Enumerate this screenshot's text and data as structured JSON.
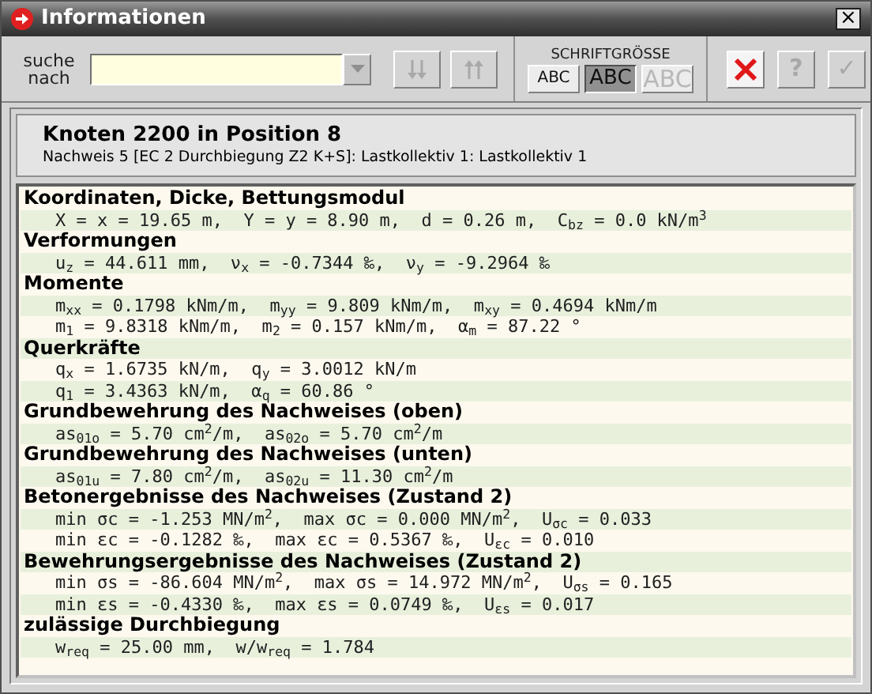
{
  "window": {
    "title": "Informationen",
    "close": "×"
  },
  "search": {
    "label": "suche nach"
  },
  "toolbar": {
    "down_disabled": true,
    "up_disabled": true
  },
  "font_size": {
    "label": "SCHRIFTGRÖSSE",
    "options": [
      {
        "label": "ABC",
        "selected": false,
        "disabled": false
      },
      {
        "label": "ABC",
        "selected": true,
        "disabled": false
      },
      {
        "label": "ABC",
        "selected": false,
        "disabled": true
      }
    ]
  },
  "actions": [
    {
      "kind": "close",
      "disabled": false
    },
    {
      "kind": "help",
      "label": "?",
      "disabled": true
    },
    {
      "kind": "ok",
      "label": "✓",
      "disabled": true
    }
  ],
  "header": {
    "title": "Knoten 2200 in Position 8",
    "subtitle": "Nachweis 5 [EC 2 Durchbiegung Z2 K+S]: Lastkollektiv 1: Lastkollektiv 1"
  },
  "lines": [
    {
      "kind": "heading",
      "text": "Koordinaten, Dicke, Bettungsmodul"
    },
    {
      "kind": "values",
      "text": "X = x = 19.65 m,  Y = y = 8.90 m,  d = 0.26 m,  C$_{bz}$ = 0.0 kN/m$^{3}$"
    },
    {
      "kind": "heading",
      "text": "Verformungen"
    },
    {
      "kind": "values",
      "text": "u$_{z}$ = 44.611 mm,  ν$_{x}$ = -0.7344 ‰,  ν$_{y}$ = -9.2964 ‰"
    },
    {
      "kind": "heading",
      "text": "Momente"
    },
    {
      "kind": "values",
      "text": "m$_{xx}$ = 0.1798 kNm/m,  m$_{yy}$ = 9.809 kNm/m,  m$_{xy}$ = 0.4694 kNm/m"
    },
    {
      "kind": "values",
      "text": "m$_{1}$ = 9.8318 kNm/m,  m$_{2}$ = 0.157 kNm/m,  α$_{m}$ = 87.22 °"
    },
    {
      "kind": "heading",
      "text": "Querkräfte"
    },
    {
      "kind": "values",
      "text": "q$_{x}$ = 1.6735 kN/m,  q$_{y}$ = 3.0012 kN/m"
    },
    {
      "kind": "values",
      "text": "q$_{1}$ = 3.4363 kN/m,  α$_{q}$ = 60.86 °"
    },
    {
      "kind": "heading",
      "text": "Grundbewehrung des Nachweises (oben)"
    },
    {
      "kind": "values",
      "text": "as$_{01o}$ = 5.70 cm$^{2}$/m,  as$_{02o}$ = 5.70 cm$^{2}$/m"
    },
    {
      "kind": "heading",
      "text": "Grundbewehrung des Nachweises (unten)"
    },
    {
      "kind": "values",
      "text": "as$_{01u}$ = 7.80 cm$^{2}$/m,  as$_{02u}$ = 11.30 cm$^{2}$/m"
    },
    {
      "kind": "heading",
      "text": "Betonergebnisse des Nachweises (Zustand 2)"
    },
    {
      "kind": "values",
      "text": "min σc = -1.253 MN/m$^{2}$,  max σc = 0.000 MN/m$^{2}$,  U$_{σc}$ = 0.033"
    },
    {
      "kind": "values",
      "text": "min εc = -0.1282 ‰,  max εc = 0.5367 ‰,  U$_{εc}$ = 0.010"
    },
    {
      "kind": "heading",
      "text": "Bewehrungsergebnisse des Nachweises (Zustand 2)"
    },
    {
      "kind": "values",
      "text": "min σs = -86.604 MN/m$^{2}$,  max σs = 14.972 MN/m$^{2}$,  U$_{σs}$ = 0.165"
    },
    {
      "kind": "values",
      "text": "min εs = -0.4330 ‰,  max εs = 0.0749 ‰,  U$_{εs}$ = 0.017"
    },
    {
      "kind": "heading",
      "text": "zulässige Durchbiegung"
    },
    {
      "kind": "values",
      "text": "w$_{req}$ = 25.00 mm,  w/w$_{req}$ = 1.784"
    }
  ]
}
